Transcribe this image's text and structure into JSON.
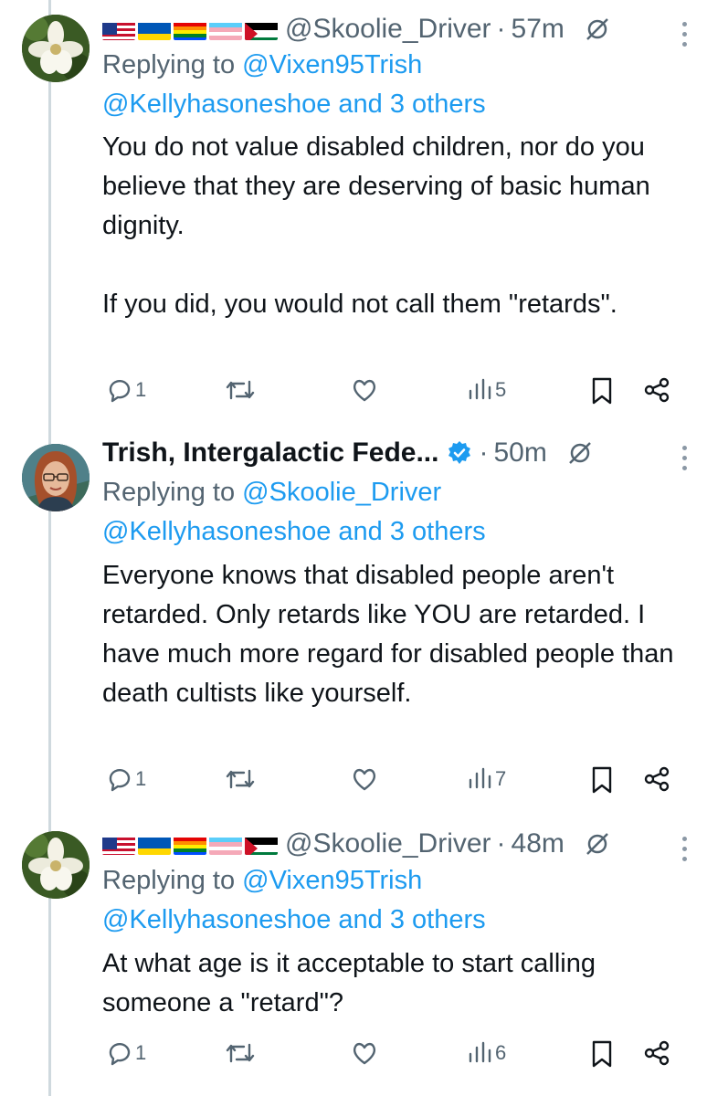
{
  "tweets": [
    {
      "handle": "@Skoolie_Driver",
      "time": "57m",
      "reply_prefix": "Replying to",
      "reply_to": "@Vixen95Trish",
      "mentions": "@Kellyhasoneshoe and 3 others",
      "text": "You do not value disabled children, nor do you believe that they are deserving of basic human dignity.\n\nIf you did, you would not call them \"retards\".",
      "replies": "1",
      "views": "5"
    },
    {
      "display_name": "Trish, Intergalactic Fede...",
      "time": "50m",
      "reply_prefix": "Replying to",
      "reply_to": "@Skoolie_Driver",
      "mentions": "@Kellyhasoneshoe and 3 others",
      "text": "Everyone knows that disabled people aren't retarded. Only retards like YOU are retarded. I have much more regard for disabled people than death cultists like yourself.",
      "replies": "1",
      "views": "7"
    },
    {
      "handle": "@Skoolie_Driver",
      "time": "48m",
      "reply_prefix": "Replying to",
      "reply_to": "@Vixen95Trish",
      "mentions": "@Kellyhasoneshoe and 3 others",
      "text": "At what age is it acceptable to start calling someone a \"retard\"?",
      "replies": "1",
      "views": "6"
    }
  ],
  "separator": "·",
  "colors": {
    "text": "#0f1419",
    "secondary": "#536471",
    "link": "#1d9bf0",
    "thread_line": "#cfd9de",
    "verified": "#1d9bf0"
  },
  "icons": [
    "magnolia-avatar",
    "woman-portrait-avatar",
    "usa-flag",
    "ukraine-flag",
    "pride-flag",
    "trans-flag",
    "palestine-flag",
    "verified-badge-icon",
    "grok-icon",
    "more-icon",
    "reply-icon",
    "retweet-icon",
    "like-icon",
    "views-icon",
    "bookmark-icon",
    "share-icon"
  ]
}
